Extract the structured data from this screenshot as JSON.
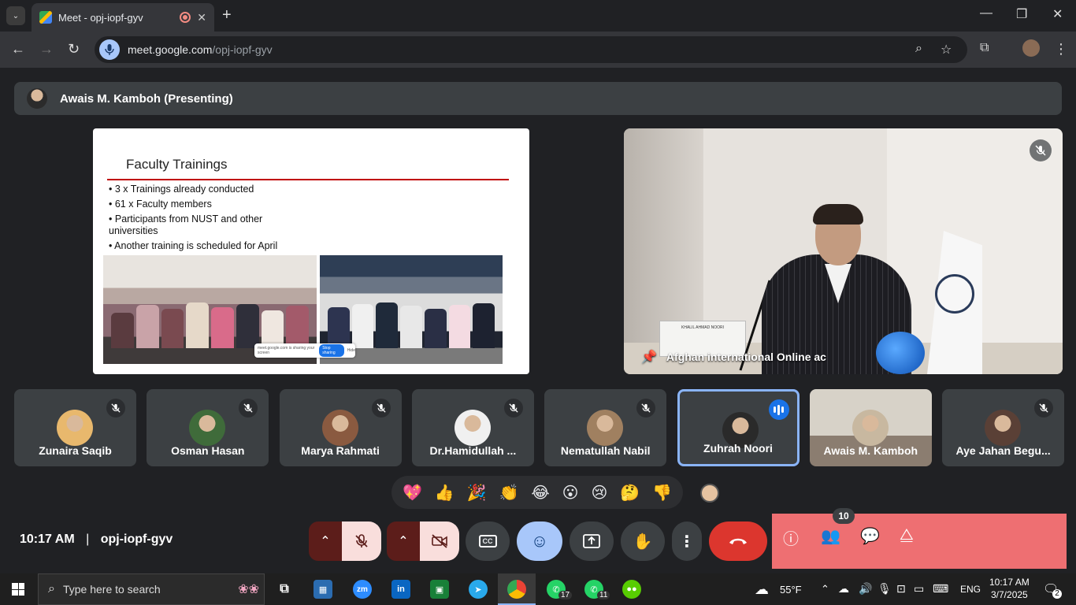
{
  "browser": {
    "tab_title": "Meet - opj-iopf-gyv",
    "url_host": "meet.google.com",
    "url_path": "/opj-iopf-gyv"
  },
  "meet": {
    "presenting_label": "Awais M. Kamboh (Presenting)",
    "slide": {
      "title": "Faculty Trainings",
      "bullets": [
        "3 x Trainings already conducted",
        "61 x Faculty members",
        "Participants from NUST and other universities",
        "Another training is scheduled for April"
      ],
      "share_toast_text": "meet.google.com is sharing your screen",
      "share_toast_button": "Stop sharing",
      "share_toast_hide": "Hide"
    },
    "main_video": {
      "label": "Afghan international Online ac",
      "nameplate": "KHALIL AHMAD NOORI"
    },
    "participants": [
      {
        "name": "Zunaira Saqib",
        "muted": true,
        "color": "#e8b86d"
      },
      {
        "name": "Osman Hasan",
        "muted": true,
        "color": "#3f6b3a"
      },
      {
        "name": "Marya Rahmati",
        "muted": true,
        "color": "#8a5a40"
      },
      {
        "name": "Dr.Hamidullah ...",
        "muted": true,
        "color": "#f0f0f0"
      },
      {
        "name": "Nematullah Nabil",
        "muted": true,
        "color": "#a08060"
      },
      {
        "name": "Zuhrah Noori",
        "muted": false,
        "color": "#2a2a2a"
      },
      {
        "name": "Awais M. Kamboh",
        "muted": false,
        "color": "#c8b8a0"
      },
      {
        "name": "Aye Jahan Begu...",
        "muted": true,
        "color": "#5a4036"
      }
    ],
    "reactions": [
      "💖",
      "👍",
      "🎉",
      "👏",
      "😂",
      "😮",
      "😢",
      "🤔",
      "👎"
    ],
    "clock": "10:17 AM",
    "separator": "|",
    "meeting_code": "opj-iopf-gyv",
    "people_count": "10"
  },
  "taskbar": {
    "search_placeholder": "Type here to search",
    "weather": "55°F",
    "language": "ENG",
    "time": "10:17 AM",
    "date": "3/7/2025",
    "whatsapp1_badge": "17",
    "whatsapp2_badge": "11",
    "notif_count": "2"
  }
}
